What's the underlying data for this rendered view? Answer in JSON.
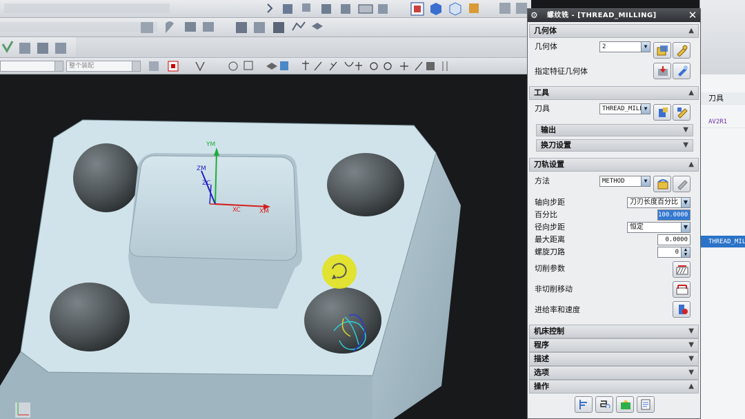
{
  "dialog": {
    "title": "螺纹铣 - [THREAD_MILLING]",
    "close_label": "✕",
    "sections": {
      "geometry": {
        "label": "几何体",
        "geometry_label": "几何体",
        "geometry_value": "2",
        "specify_feature_label": "指定特征几何体"
      },
      "tool": {
        "label": "工具",
        "tool_label": "刀具",
        "tool_value": "THREAD_MILL",
        "output_label": "输出",
        "tool_change_label": "换刀设置"
      },
      "path": {
        "label": "刀轨设置",
        "method_label": "方法",
        "method_value": "METHOD",
        "axial_step_label": "轴向步距",
        "axial_step_value": "刀刃长度百分比",
        "percent_label": "百分比",
        "percent_value": "100.0000",
        "radial_step_label": "径向步距",
        "radial_step_value": "恒定",
        "max_distance_label": "最大距离",
        "max_distance_value": "0.0000",
        "spiral_paths_label": "螺旋刀路",
        "spiral_paths_value": "0",
        "cut_params_label": "切削参数",
        "non_cut_label": "非切削移动",
        "feeds_label": "进给率和速度"
      },
      "machine": {
        "label": "机床控制"
      },
      "program": {
        "label": "程序"
      },
      "description": {
        "label": "描述"
      },
      "options": {
        "label": "选项"
      },
      "actions": {
        "label": "操作"
      }
    }
  },
  "right_panel": {
    "header": "刀具",
    "row1": "AV2R1",
    "row2": "THREAD_MILL"
  },
  "viewport": {
    "axes": {
      "ym": "YM",
      "zm": "ZM",
      "zc": "ZC",
      "xc": "XC",
      "xm": "XM"
    },
    "colors": {
      "background": "#17191b",
      "part_top": "#cfe2ea",
      "part_side": "#a9bfca",
      "hole": "#5b6266",
      "highlight": "#e2e222"
    }
  },
  "toolbar": {
    "selection_filter": "整个装配"
  }
}
